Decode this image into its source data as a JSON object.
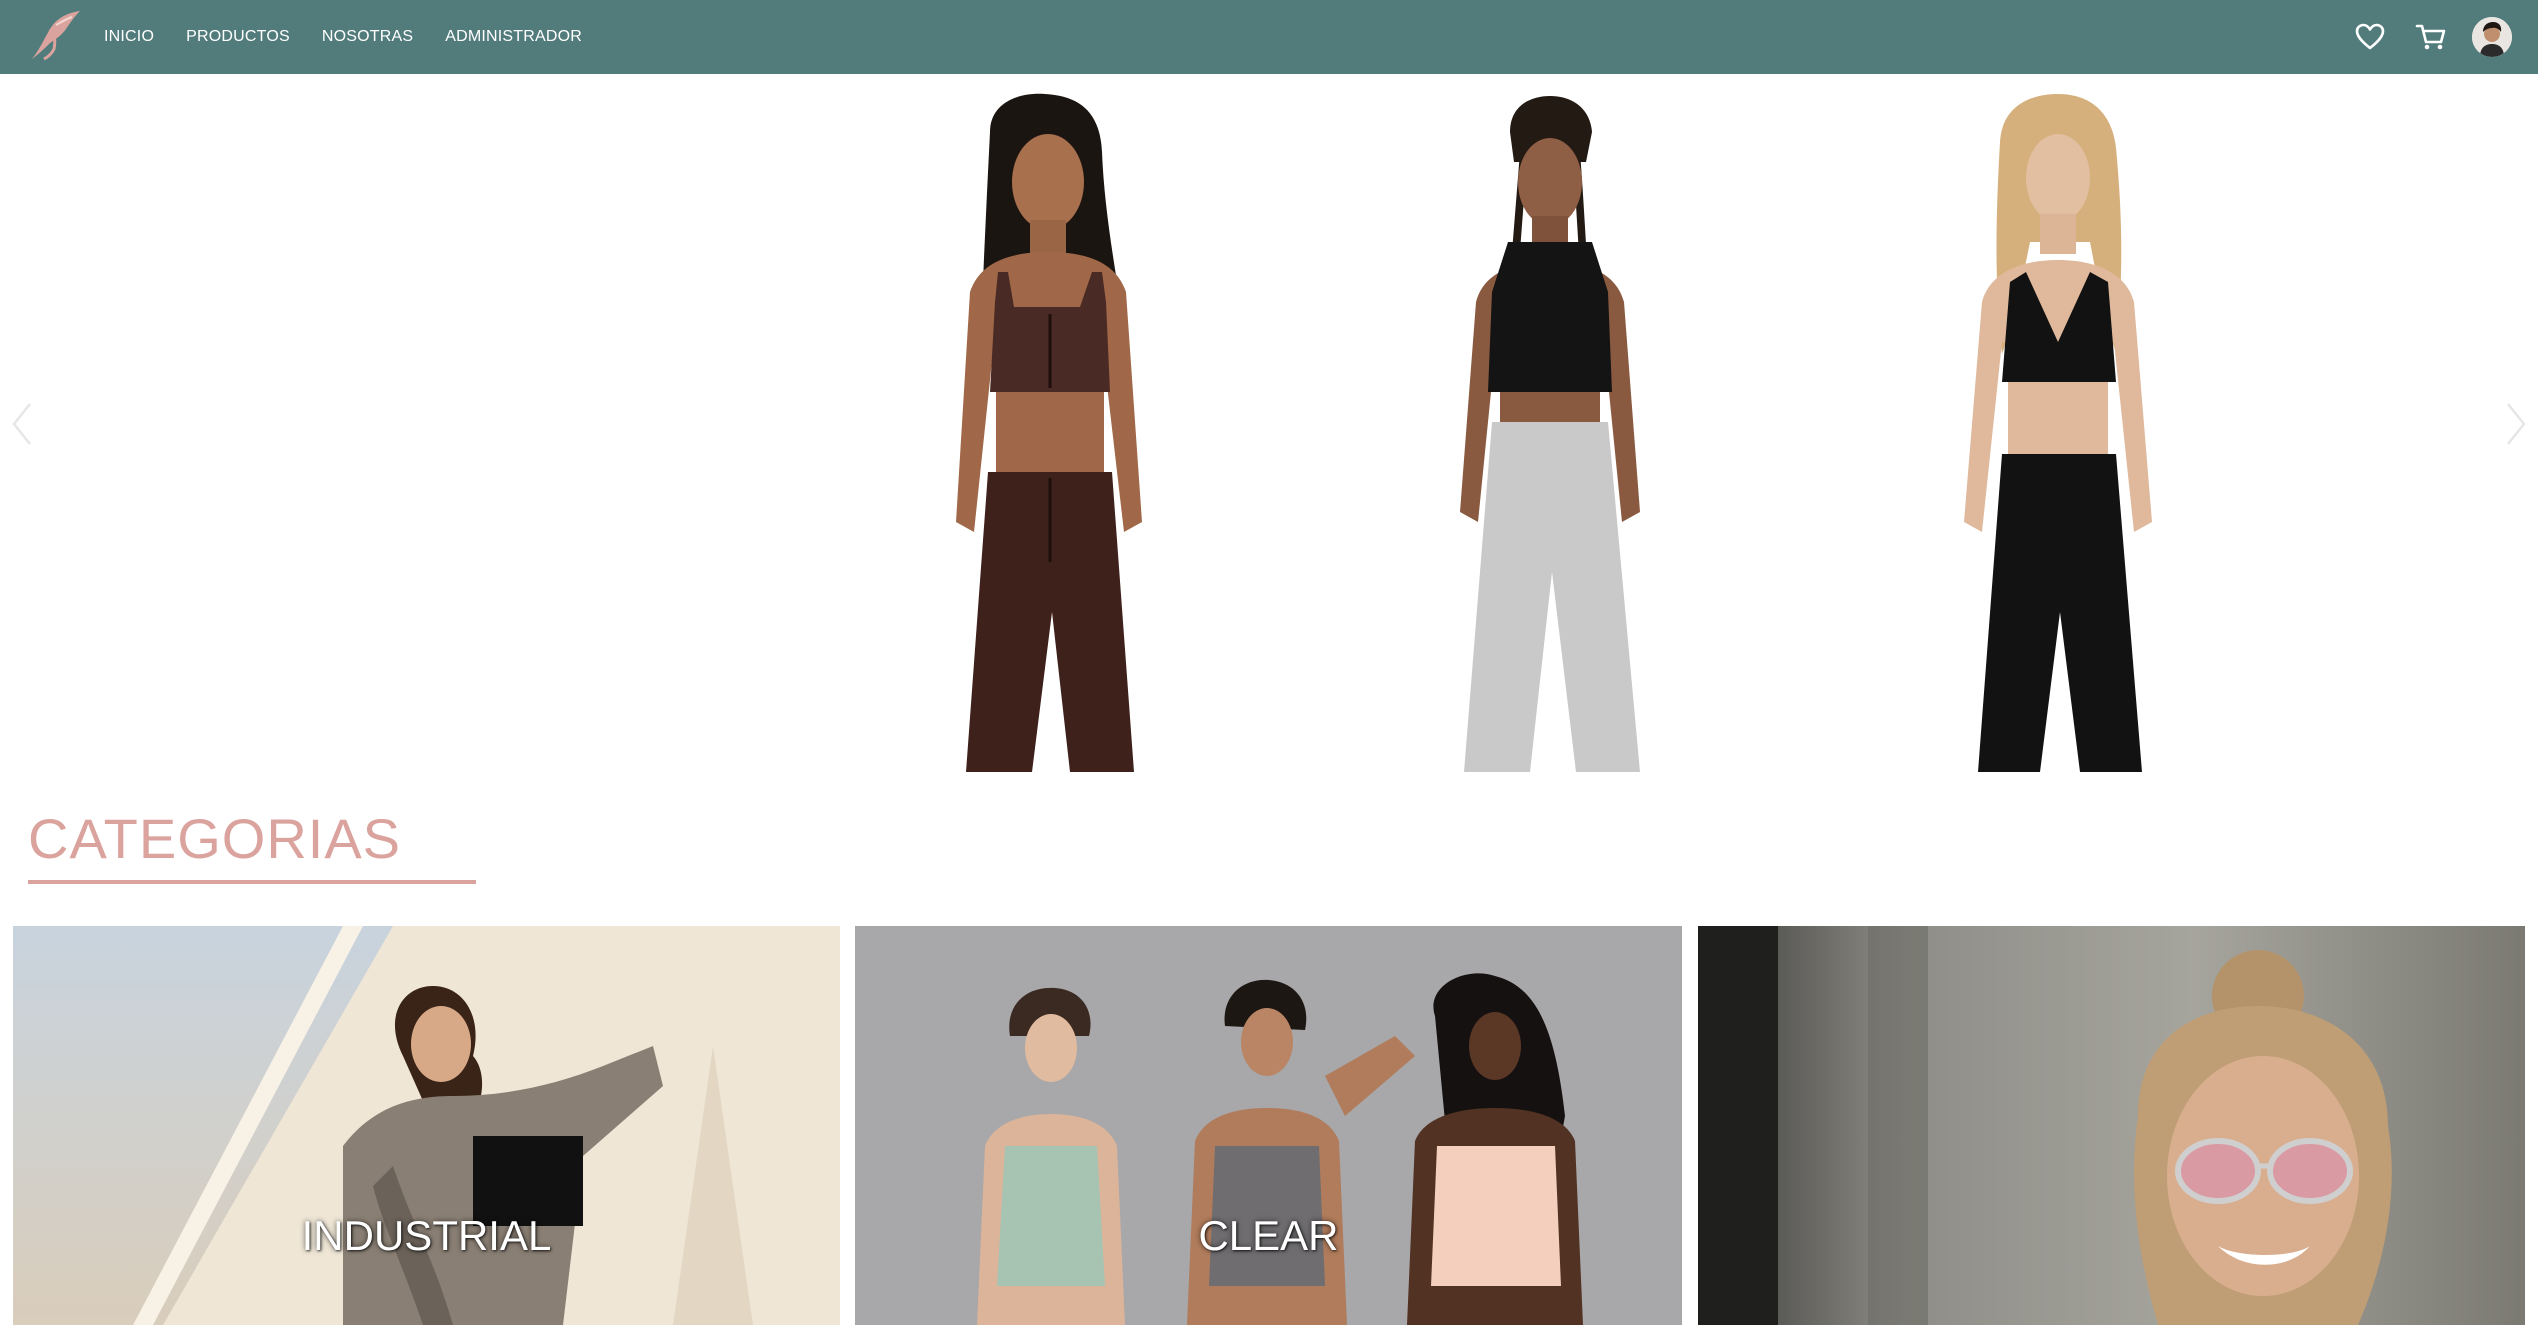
{
  "nav": {
    "links": [
      "INICIO",
      "PRODUCTOS",
      "NOSOTRAS",
      "ADMINISTRADOR"
    ],
    "icons": [
      "heart-icon",
      "cart-icon",
      "user-avatar"
    ]
  },
  "carousel": {
    "slides": [
      {
        "outfit_top": "#4a2a24",
        "outfit_bottom": "#3f211c"
      },
      {
        "outfit_top": "#141414",
        "outfit_bottom": "#c9c9c9"
      },
      {
        "outfit_top": "#121212",
        "outfit_bottom": "#121212"
      }
    ]
  },
  "categories": {
    "title": "CATEGORIAS",
    "items": [
      {
        "label": "INDUSTRIAL"
      },
      {
        "label": "CLEAR"
      },
      {
        "label": ""
      }
    ]
  },
  "colors": {
    "navbar": "#527c7c",
    "accent": "#dba39d",
    "white": "#ffffff"
  }
}
